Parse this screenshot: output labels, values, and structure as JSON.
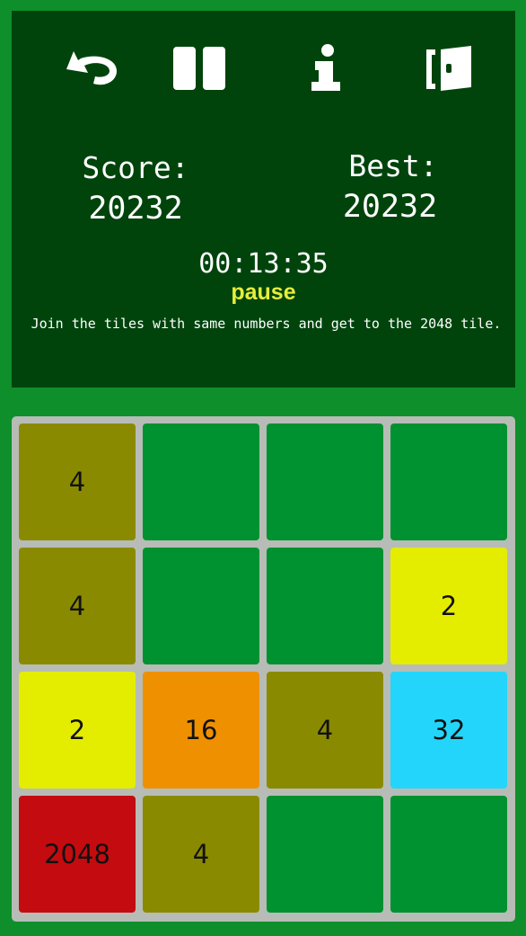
{
  "toolbar": {
    "undo_icon": "undo-icon",
    "pause_icon": "pause-icon",
    "info_icon": "info-icon",
    "exit_icon": "exit-door-icon"
  },
  "score": {
    "label": "Score:",
    "value": "20232"
  },
  "best": {
    "label": "Best:",
    "value": "20232"
  },
  "timer": "00:13:35",
  "pause_label": "pause",
  "instructions": "Join the tiles with same numbers and get to the 2048 tile.",
  "board": {
    "rows": [
      [
        "4",
        "",
        "",
        ""
      ],
      [
        "4",
        "",
        "",
        "2"
      ],
      [
        "2",
        "16",
        "4",
        "32"
      ],
      [
        "2048",
        "4",
        "",
        ""
      ]
    ]
  },
  "colors": {
    "background": "#0e8f2c",
    "header": "#00440c",
    "board": "#b7bcb6",
    "empty_tile": "#009130",
    "tile_2": "#e4ec00",
    "tile_4": "#8a8a00",
    "tile_16": "#ef9000",
    "tile_32": "#23d5fb",
    "tile_2048": "#c40b10",
    "pause_text": "#e6ee3a"
  }
}
